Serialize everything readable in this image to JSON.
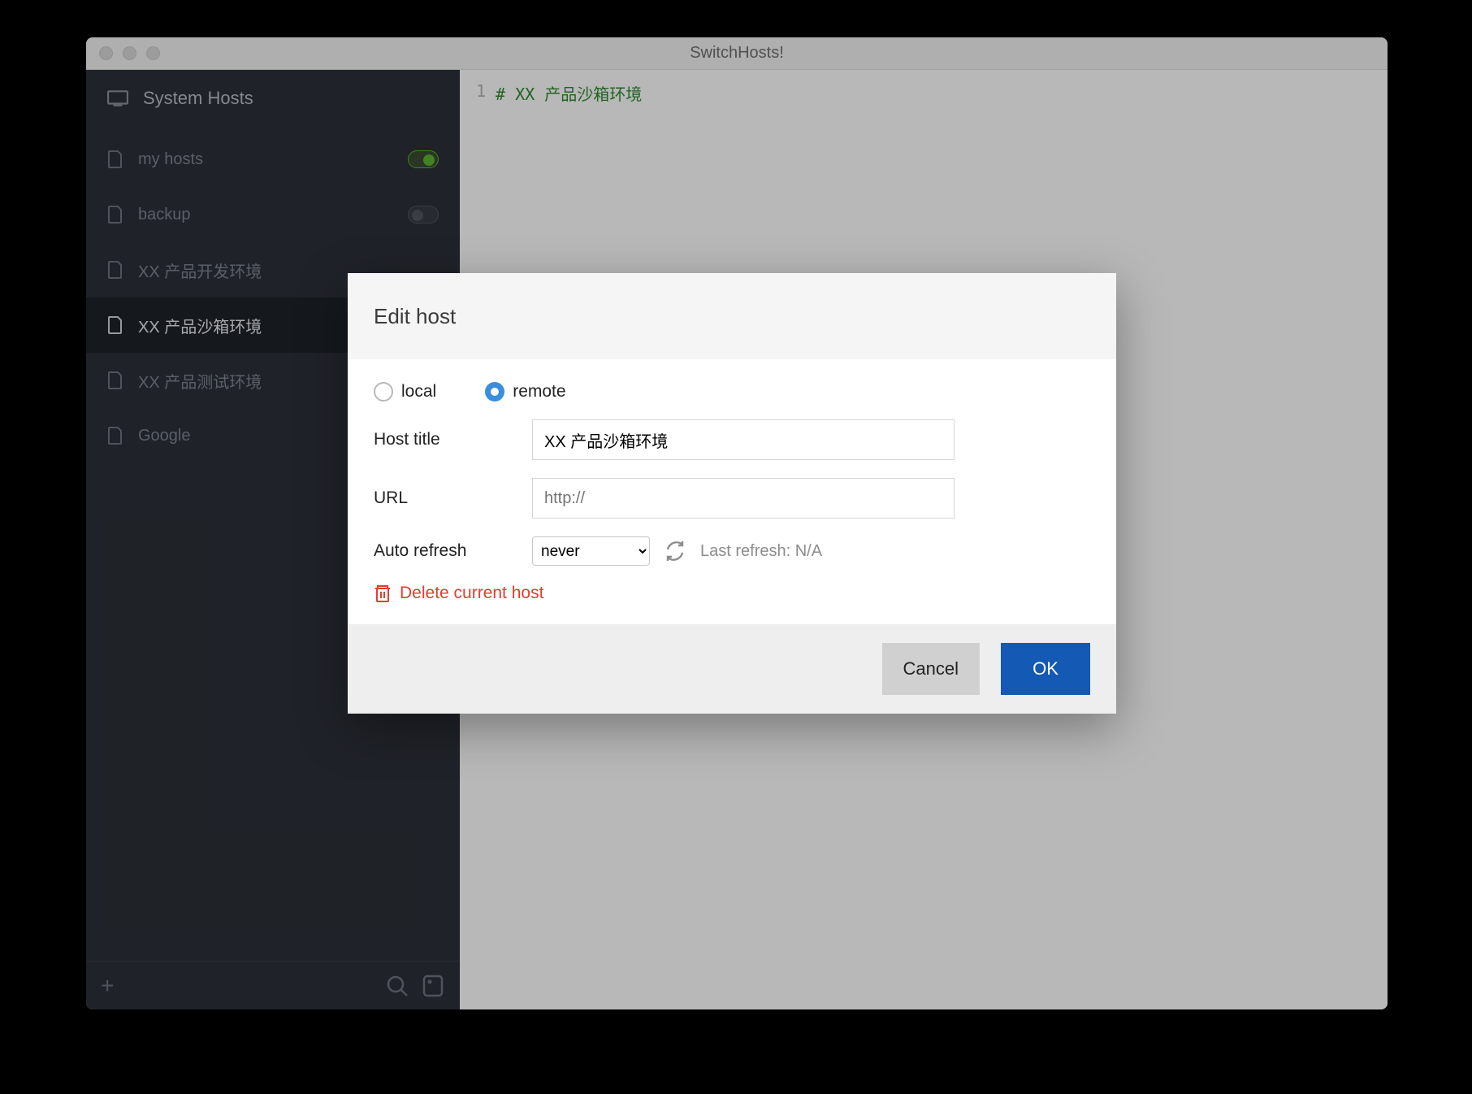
{
  "window": {
    "title": "SwitchHosts!"
  },
  "sidebar": {
    "system_hosts_label": "System Hosts",
    "items": [
      {
        "label": "my hosts",
        "enabled": true
      },
      {
        "label": "backup",
        "enabled": false
      },
      {
        "label": "XX 产品开发环境",
        "enabled": null
      },
      {
        "label": "XX 产品沙箱环境",
        "enabled": null,
        "active": true
      },
      {
        "label": "XX 产品测试环境",
        "enabled": null
      },
      {
        "label": "Google",
        "enabled": null
      }
    ]
  },
  "editor": {
    "lines": [
      {
        "num": "1",
        "text": "# XX 产品沙箱环境"
      }
    ]
  },
  "dialog": {
    "title": "Edit host",
    "type_local_label": "local",
    "type_remote_label": "remote",
    "type_selected": "remote",
    "host_title_label": "Host title",
    "host_title_value": "XX 产品沙箱环境",
    "url_label": "URL",
    "url_value": "",
    "url_placeholder": "http://",
    "auto_refresh_label": "Auto refresh",
    "auto_refresh_value": "never",
    "last_refresh_label": "Last refresh: N/A",
    "delete_label": "Delete current host",
    "cancel_label": "Cancel",
    "ok_label": "OK"
  }
}
